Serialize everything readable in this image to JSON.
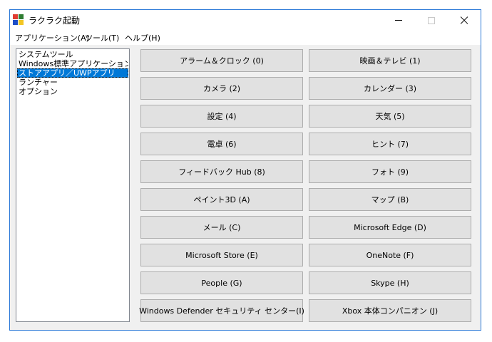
{
  "window": {
    "title": "ラクラク起動",
    "controls": [
      "minimize-icon",
      "maximize-icon",
      "close-icon"
    ]
  },
  "menu": {
    "items": [
      "アプリケーション(A)",
      "ツール(T)",
      "ヘルプ(H)"
    ]
  },
  "sidebar": {
    "items": [
      {
        "label": "システムツール"
      },
      {
        "label": "Windows標準アプリケーション"
      },
      {
        "label": "ストアアプリ／UWPアプリ",
        "selected": true
      },
      {
        "label": "ランチャー"
      },
      {
        "label": "オプション"
      }
    ]
  },
  "buttons": [
    "アラーム＆クロック (0)",
    "映画＆テレビ (1)",
    "カメラ (2)",
    "カレンダー (3)",
    "設定 (4)",
    "天気 (5)",
    "電卓 (6)",
    "ヒント (7)",
    "フィードバック Hub (8)",
    "フォト (9)",
    "ペイント3D (A)",
    "マップ (B)",
    "メール (C)",
    "Microsoft Edge (D)",
    "Microsoft Store (E)",
    "OneNote (F)",
    "People (G)",
    "Skype (H)",
    "Windows Defender セキュリティ センター(I)",
    "Xbox 本体コンパニオン (J)"
  ],
  "colors": {
    "selection": "#0078d7",
    "window_border": "#2b79d7",
    "client_background": "#f0f0f0",
    "button_face": "#e1e1e1"
  }
}
